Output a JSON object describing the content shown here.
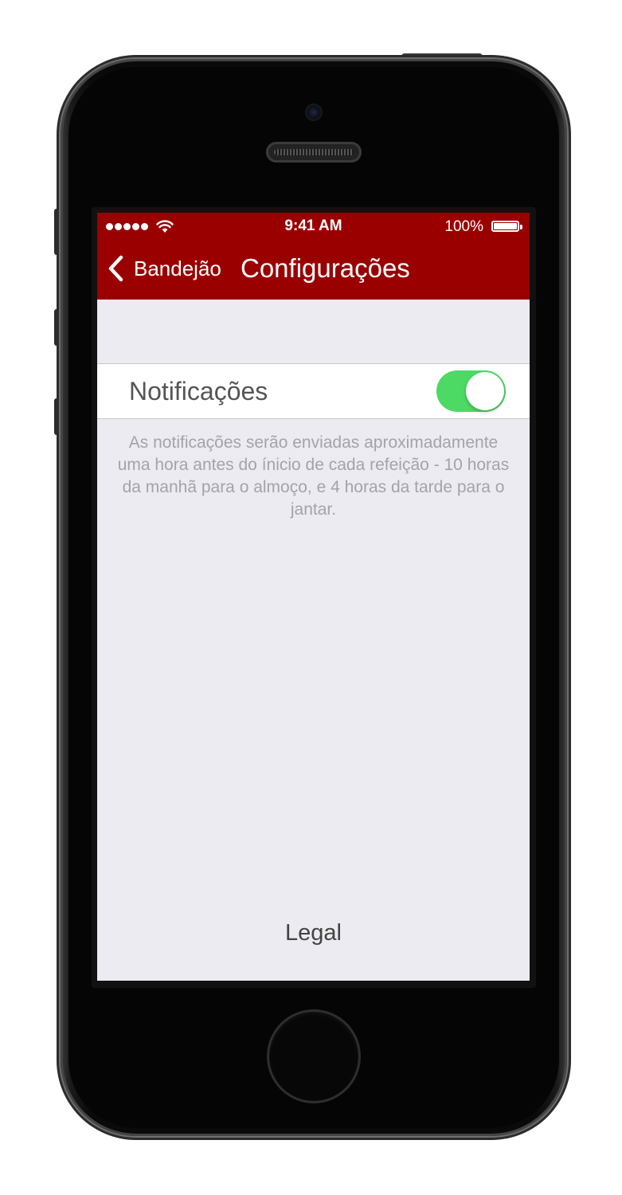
{
  "status_bar": {
    "signal_dots": 5,
    "time": "9:41 AM",
    "battery_percent": "100%"
  },
  "nav_bar": {
    "back_label": "Bandejão",
    "title": "Configurações",
    "color": "#9b0000"
  },
  "settings": {
    "notifications": {
      "label": "Notificações",
      "enabled": true,
      "toggle_color": "#4cd964"
    },
    "notifications_note": "As notificações serão enviadas aproximadamente uma hora antes do ínicio de cada refeição - 10 horas da manhã para o almoço, e 4 horas da tarde para o jantar."
  },
  "legal_label": "Legal"
}
